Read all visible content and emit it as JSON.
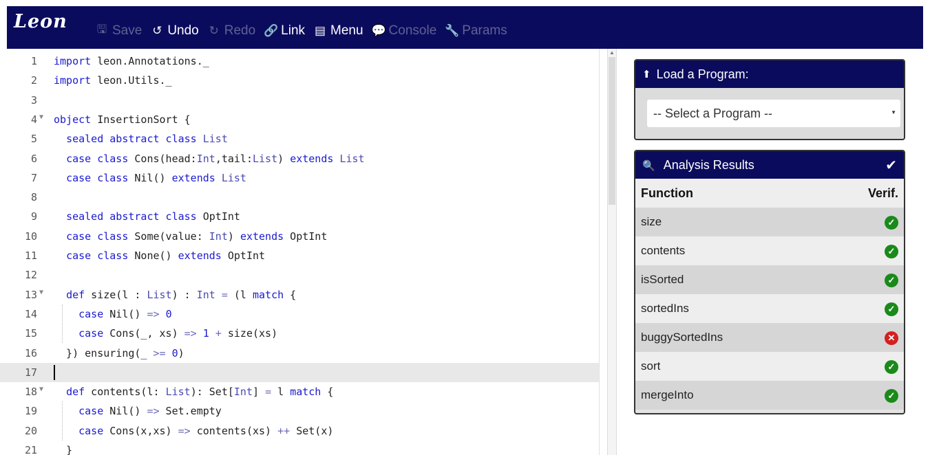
{
  "app": {
    "logo": "Leon"
  },
  "toolbar": [
    {
      "name": "save-button",
      "icon": "save-icon",
      "glyph": "🖫",
      "label": "Save",
      "enabled": false
    },
    {
      "name": "undo-button",
      "icon": "undo-icon",
      "glyph": "↺",
      "label": "Undo",
      "enabled": true
    },
    {
      "name": "redo-button",
      "icon": "redo-icon",
      "glyph": "↻",
      "label": "Redo",
      "enabled": false
    },
    {
      "name": "link-button",
      "icon": "link-icon",
      "glyph": "🔗",
      "label": "Link",
      "enabled": true
    },
    {
      "name": "menu-button",
      "icon": "menu-icon",
      "glyph": "▤",
      "label": "Menu",
      "enabled": true
    },
    {
      "name": "console-button",
      "icon": "console-icon",
      "glyph": "💬",
      "label": "Console",
      "enabled": false
    },
    {
      "name": "params-button",
      "icon": "wrench-icon",
      "glyph": "🔧",
      "label": "Params",
      "enabled": false
    }
  ],
  "editor": {
    "active_line": 17,
    "lines": [
      {
        "n": "1",
        "fold": false,
        "html": "<span class=\"kw\">import</span> leon.Annotations._"
      },
      {
        "n": "2",
        "fold": false,
        "html": "<span class=\"kw\">import</span> leon.Utils._"
      },
      {
        "n": "3",
        "fold": false,
        "html": ""
      },
      {
        "n": "4",
        "fold": true,
        "html": "<span class=\"kw\">object</span> InsertionSort {"
      },
      {
        "n": "5",
        "fold": false,
        "html": "  <span class=\"kw\">sealed abstract class</span> <span class=\"ty\">List</span>"
      },
      {
        "n": "6",
        "fold": false,
        "html": "  <span class=\"kw\">case class</span> Cons(head:<span class=\"ty\">Int</span>,tail:<span class=\"ty\">List</span>) <span class=\"kw\">extends</span> <span class=\"ty\">List</span>"
      },
      {
        "n": "7",
        "fold": false,
        "html": "  <span class=\"kw\">case class</span> Nil() <span class=\"kw\">extends</span> <span class=\"ty\">List</span>"
      },
      {
        "n": "8",
        "fold": false,
        "html": ""
      },
      {
        "n": "9",
        "fold": false,
        "html": "  <span class=\"kw\">sealed abstract class</span> OptInt"
      },
      {
        "n": "10",
        "fold": false,
        "html": "  <span class=\"kw\">case class</span> Some(value: <span class=\"ty\">Int</span>) <span class=\"kw\">extends</span> OptInt"
      },
      {
        "n": "11",
        "fold": false,
        "html": "  <span class=\"kw\">case class</span> None() <span class=\"kw\">extends</span> OptInt"
      },
      {
        "n": "12",
        "fold": false,
        "html": ""
      },
      {
        "n": "13",
        "fold": true,
        "html": "  <span class=\"kw\">def</span> size(l : <span class=\"ty\">List</span>) : <span class=\"ty\">Int</span> <span class=\"op\">=</span> (l <span class=\"kw\">match</span> {"
      },
      {
        "n": "14",
        "fold": false,
        "html": "    <span class=\"kw\">case</span> Nil() <span class=\"op\">=&gt;</span> <span class=\"num\">0</span>"
      },
      {
        "n": "15",
        "fold": false,
        "html": "    <span class=\"kw\">case</span> Cons(_, xs) <span class=\"op\">=&gt;</span> <span class=\"num\">1</span> <span class=\"op\">+</span> size(xs)"
      },
      {
        "n": "16",
        "fold": false,
        "html": "  }) ensuring(_ <span class=\"op\">&gt;=</span> <span class=\"num\">0</span>)"
      },
      {
        "n": "17",
        "fold": false,
        "html": ""
      },
      {
        "n": "18",
        "fold": true,
        "html": "  <span class=\"kw\">def</span> contents(l: <span class=\"ty\">List</span>): Set[<span class=\"ty\">Int</span>] <span class=\"op\">=</span> l <span class=\"kw\">match</span> {"
      },
      {
        "n": "19",
        "fold": false,
        "html": "    <span class=\"kw\">case</span> Nil() <span class=\"op\">=&gt;</span> Set.empty"
      },
      {
        "n": "20",
        "fold": false,
        "html": "    <span class=\"kw\">case</span> Cons(x,xs) <span class=\"op\">=&gt;</span> contents(xs) <span class=\"op\">++</span> Set(x)"
      },
      {
        "n": "21",
        "fold": false,
        "html": "  }"
      }
    ]
  },
  "load_panel": {
    "title": "Load a Program:",
    "icon": "circle-up-arrow-icon",
    "select_value": "-- Select a Program --"
  },
  "results_panel": {
    "title": "Analysis Results",
    "icon": "search-icon",
    "status_icon": "checkmark-icon",
    "col_function": "Function",
    "col_verif": "Verif.",
    "rows": [
      {
        "fn": "size",
        "status": "ok"
      },
      {
        "fn": "contents",
        "status": "ok"
      },
      {
        "fn": "isSorted",
        "status": "ok"
      },
      {
        "fn": "sortedIns",
        "status": "ok"
      },
      {
        "fn": "buggySortedIns",
        "status": "err"
      },
      {
        "fn": "sort",
        "status": "ok"
      },
      {
        "fn": "mergeInto",
        "status": "ok"
      }
    ]
  },
  "colors": {
    "header": "#0b0b5e",
    "ok": "#1a8a1a",
    "err": "#d42020",
    "keyword": "#1a1ad0"
  }
}
